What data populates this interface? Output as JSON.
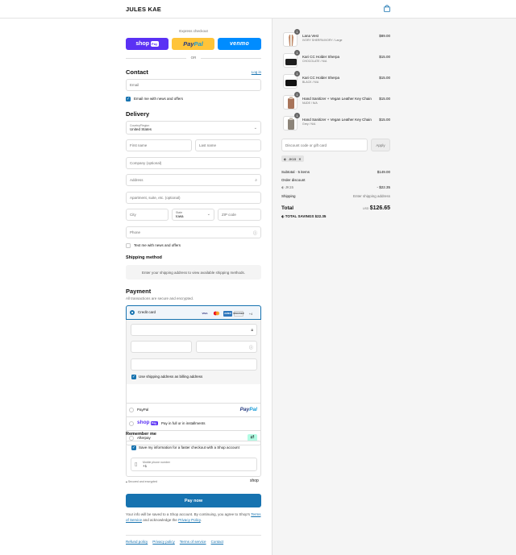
{
  "header": {
    "brand": "JULES KAE",
    "cart_icon": "shopping-bag-icon"
  },
  "express": {
    "title": "Express checkout",
    "shop_label": "shop",
    "shop_pay": "Pay",
    "paypal_pay": "Pay",
    "paypal_pal": "Pal",
    "venmo_label": "venmo",
    "or": "OR"
  },
  "contact": {
    "title": "Contact",
    "login": "Log in",
    "email_placeholder": "Email",
    "news_label": "Email me with news and offers",
    "news_checked": true
  },
  "delivery": {
    "title": "Delivery",
    "country_label": "Country/Region",
    "country_value": "United States",
    "first_name": "First name",
    "last_name": "Last name",
    "company": "Company (optional)",
    "address": "Address",
    "apartment": "Apartment, suite, etc. (optional)",
    "city": "City",
    "state_label": "State",
    "state_value": "Iowa",
    "zip": "ZIP code",
    "phone": "Phone",
    "text_label": "Text me with news and offers",
    "text_checked": false
  },
  "shipping": {
    "title": "Shipping method",
    "notice": "Enter your shipping address to view available shipping methods."
  },
  "payment": {
    "title": "Payment",
    "subtitle": "All transactions are secure and encrypted.",
    "credit_card": "Credit card",
    "card_logos": [
      "VISA",
      "MC",
      "AMEX",
      "DISCOVER"
    ],
    "more_cards": "+4",
    "billing_label": "Use shipping address as billing address",
    "billing_checked": true,
    "paypal": "PayPal",
    "paypal_logo_pay": "Pay",
    "paypal_logo_pal": "Pal",
    "shop_pay_logo": "shop",
    "shop_pay_badge": "Pay",
    "shop_pay_label": "Pay in full or in installments",
    "afterpay": "Afterpay"
  },
  "remember": {
    "title": "Remember me",
    "save_label": "Save my information for a faster checkout with a Shop account",
    "save_checked": true,
    "phone_label": "Mobile phone number",
    "phone_value": "+1",
    "secure": "Secured and encrypted",
    "shop_logo": "shop"
  },
  "pay_now": "Pay now",
  "legal": {
    "text1": "Your info will be saved to a Shop account. By continuing, you agree to Shop's",
    "tos": "Terms of Service",
    "and": " and acknowledge the ",
    "privacy": "Privacy Policy",
    "end": "."
  },
  "footer_links": [
    "Refund policy",
    "Privacy policy",
    "Terms of service",
    "Contact"
  ],
  "order": {
    "items": [
      {
        "name": "Lana Vest",
        "variant": "IVORY SHERPA/IVORY / Large",
        "price": "$89.00",
        "qty": "1",
        "thumb_color": "#c08a6a"
      },
      {
        "name": "Kari CC Holder Sherpa",
        "variant": "CHOCOLATE / N/A",
        "price": "$15.00",
        "qty": "1",
        "thumb_color": "#1e1e1e"
      },
      {
        "name": "Kari CC Holder Sherpa",
        "variant": "BLACK / N/A",
        "price": "$15.00",
        "qty": "1",
        "thumb_color": "#111111"
      },
      {
        "name": "Hand Sanitizer + Vegan Leather Key Chain",
        "variant": "NUDE / N/A",
        "price": "$15.00",
        "qty": "1",
        "thumb_color": "#a8745a"
      },
      {
        "name": "Hand Sanitizer + Vegan Leather Key Chain",
        "variant": "Grey / N/A",
        "price": "$15.00",
        "qty": "1",
        "thumb_color": "#8c8479"
      }
    ],
    "discount_placeholder": "Discount code or gift card",
    "apply": "Apply",
    "code": "JK15",
    "subtotal_label": "Subtotal · 5 items",
    "subtotal": "$149.00",
    "order_discount": "Order discount",
    "discount_code": "JK15",
    "discount_value": "- $22.35",
    "shipping_label": "Shipping",
    "shipping_value": "Enter shipping address",
    "total_label": "Total",
    "currency": "USD",
    "total": "$126.65",
    "savings_label": "TOTAL SAVINGS",
    "savings": "$22.35"
  },
  "colors": {
    "accent": "#1773b0",
    "shop": "#5a31f4",
    "paypal": "#ffc439",
    "venmo": "#008cff",
    "afterpay": "#b2fce4"
  }
}
